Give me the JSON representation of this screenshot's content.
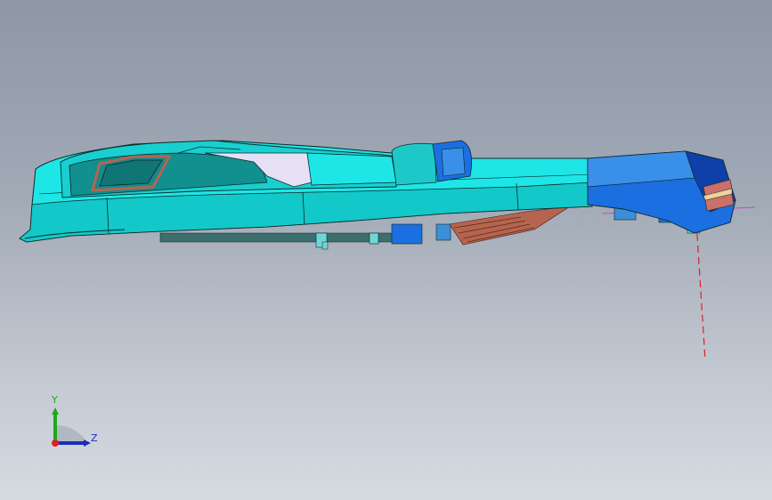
{
  "viewport": {
    "background_top": "#8d97a6",
    "background_bottom": "#d6dbe1"
  },
  "model": {
    "colors": {
      "cyan_main": "#1fe6e6",
      "cyan_dark": "#13b8b8",
      "teal_panel": "#1a8f8f",
      "blue_part": "#1b6fe0",
      "blue_dark": "#0f3fa8",
      "copper": "#b5654f",
      "lavender": "#e6e0f5",
      "edge": "#0b2a2a",
      "reference_line": "#e02020"
    }
  },
  "triad": {
    "y_label": "Y",
    "z_label": "Z",
    "y_color": "#1fa81f",
    "z_color": "#1b2fb8",
    "x_color": "#e02020"
  }
}
